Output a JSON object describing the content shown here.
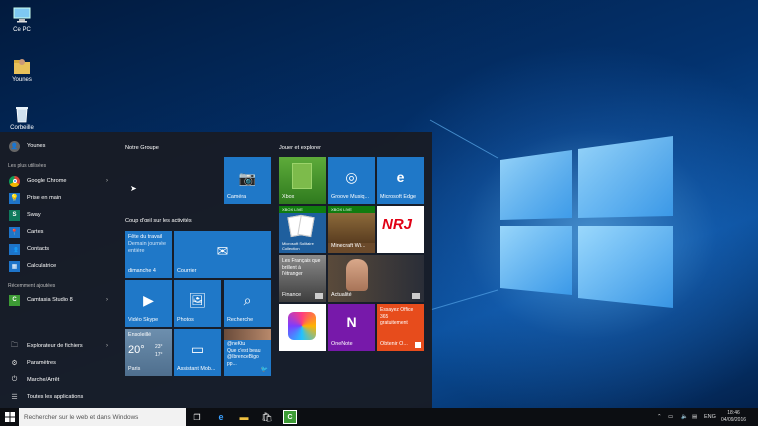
{
  "desktop": {
    "icons": [
      {
        "label": "Ce PC",
        "icon": "computer-icon"
      },
      {
        "label": "Younes",
        "icon": "user-folder-icon"
      },
      {
        "label": "Corbeille",
        "icon": "recycle-bin-icon"
      }
    ]
  },
  "start": {
    "user": "Younes",
    "most_used_label": "Les plus utilisées",
    "most_used": [
      {
        "label": "Google Chrome",
        "icon": "chrome-icon",
        "color": "#e04a3a",
        "has_submenu": true
      },
      {
        "label": "Prise en main",
        "icon": "lightbulb-icon",
        "color": "#1e74c9"
      },
      {
        "label": "Sway",
        "icon": "sway-icon",
        "color": "#0f7a5c"
      },
      {
        "label": "Cartes",
        "icon": "maps-icon",
        "color": "#1e74c9"
      },
      {
        "label": "Contacts",
        "icon": "contacts-icon",
        "color": "#1e74c9"
      },
      {
        "label": "Calculatrice",
        "icon": "calculator-icon",
        "color": "#1e74c9"
      }
    ],
    "recent_label": "Récemment ajoutées",
    "recent": [
      {
        "label": "Camtasia Studio 8",
        "icon": "camtasia-icon",
        "color": "#3d9b35",
        "has_submenu": true
      }
    ],
    "bottom": [
      {
        "label": "Explorateur de fichiers",
        "icon": "folder-icon",
        "has_submenu": true
      },
      {
        "label": "Paramètres",
        "icon": "gear-icon"
      },
      {
        "label": "Marche/Arrêt",
        "icon": "power-icon"
      },
      {
        "label": "Toutes les applications",
        "icon": "list-icon"
      }
    ],
    "groups": {
      "notre": "Notre Groupe",
      "coup": "Coup d'œil sur les activités",
      "jouer": "Jouer et explorer"
    },
    "tiles": {
      "camera": "Caméra",
      "calendar_lines": [
        "Fête du travail",
        "Demain journée",
        "entière"
      ],
      "calendar_day": "dimanche 4",
      "mail": "Courrier",
      "video": "Vidéo Skype",
      "photos": "Photos",
      "search": "Recherche",
      "weather_cond": "Ensoleillé",
      "weather_temp": "20°",
      "weather_hi": "23°",
      "weather_lo": "17°",
      "weather_city": "Paris",
      "assist": "Assistant Mob...",
      "twitter_lines": [
        "@neKtu",
        "Que c'est beau",
        "@IbrenceBigo",
        "pp..."
      ],
      "xbox": "Xbox",
      "xbox_live": "XBOX LIVE",
      "groove": "Groove Musiq...",
      "edge": "Microsoft Edge",
      "solitaire_live": "XBOX LIVE",
      "solitaire": "Microsoft Solitaire Collection",
      "minecraft_live": "XBOX LIVE",
      "minecraft": "Minecraft Wi...",
      "finance_lines": [
        "Les Français que",
        "brillent à",
        "l'étranger"
      ],
      "finance": "Finance",
      "news": "Actualité",
      "office_lines": [
        "Essayez Office",
        "365",
        "gratuitement"
      ],
      "office": "Obtenir O...",
      "onenote": "OneNote"
    }
  },
  "taskbar": {
    "search_placeholder": "Rechercher sur le web et dans Windows",
    "lang": "ENG",
    "time": "18:46",
    "date": "04/09/2016"
  },
  "colors": {
    "accent": "#1e74c9",
    "tile_blue": "#1f78c8"
  }
}
